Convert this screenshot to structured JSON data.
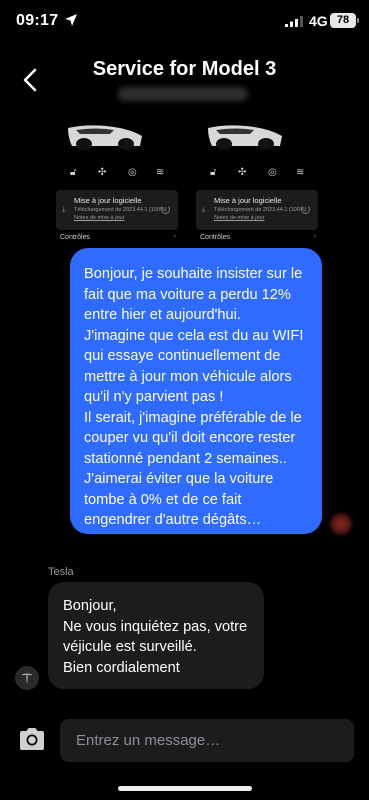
{
  "status_bar": {
    "time": "09:17",
    "network": "4G",
    "battery": "78"
  },
  "header": {
    "title": "Service for Model 3"
  },
  "attachment": {
    "update_title": "Mise à jour logicielle",
    "update_sub": "Téléchargement de 2023.44.1 (100%)",
    "update_notes": "Notes de mise à jour",
    "controls_label": "Contrôles"
  },
  "messages": {
    "outgoing": "Bonjour, je souhaite insister sur le fait que ma voiture a perdu 12% entre hier et aujourd'hui.\nJ'imagine que cela est du au WIFI qui essaye continuellement de mettre à jour mon véhicule alors qu'il n'y parvient pas !\nIl serait, j'imagine préférable de le couper vu qu'il doit encore rester stationné pendant 2 semaines..\nJ'aimerai éviter que la voiture tombe à 0% et de ce fait engendrer d'autre dégâts…",
    "sender": "Tesla",
    "incoming": "Bonjour,\nNe vous inquiétez pas, votre véjicule est surveillé.\nBien cordialement"
  },
  "composer": {
    "placeholder": "Entrez un message…"
  },
  "colors": {
    "bubble_out": "#2f6bff",
    "bubble_in": "#1c1c1e",
    "background": "#000000"
  }
}
